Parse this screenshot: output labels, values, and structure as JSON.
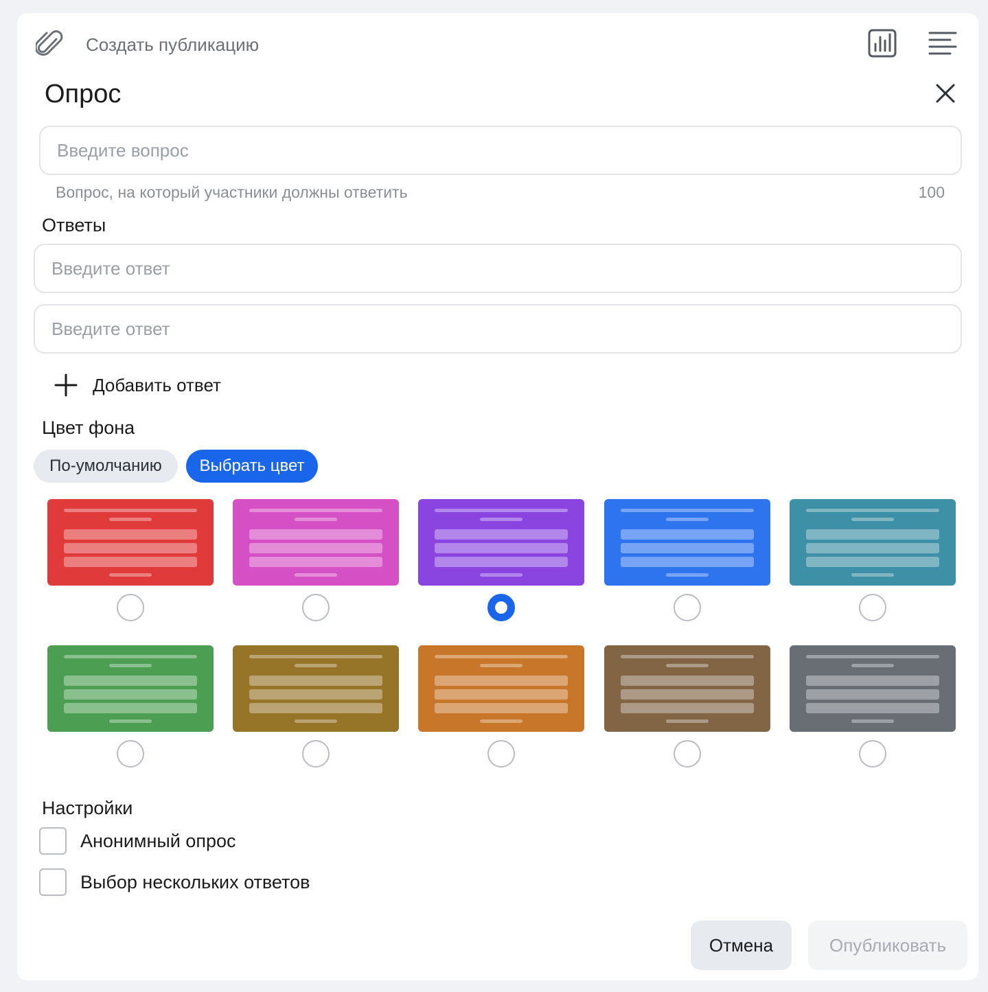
{
  "header": {
    "create_post": "Создать публикацию",
    "icons": [
      "paperclip-icon",
      "poll-chart-icon",
      "menu-lines-icon",
      "close-icon"
    ]
  },
  "poll": {
    "title": "Опрос",
    "question": {
      "placeholder": "Введите вопрос",
      "value": "",
      "hint": "Вопрос, на который участники должны ответить",
      "counter": "100"
    },
    "answers_label": "Ответы",
    "answers": [
      {
        "placeholder": "Введите ответ",
        "value": ""
      },
      {
        "placeholder": "Введите ответ",
        "value": ""
      }
    ],
    "add_answer": "Добавить ответ"
  },
  "background": {
    "label": "Цвет фона",
    "tabs": [
      {
        "label": "По-умолчанию",
        "active": false
      },
      {
        "label": "Выбрать цвет",
        "active": true
      }
    ],
    "accent": "#1a66ea",
    "selected_index": 2,
    "swatches": [
      {
        "name": "red",
        "color": "#e03a3a"
      },
      {
        "name": "pink",
        "color": "#d550c4"
      },
      {
        "name": "purple",
        "color": "#8a45e0"
      },
      {
        "name": "blue",
        "color": "#2f74ef"
      },
      {
        "name": "teal",
        "color": "#3d90a5"
      },
      {
        "name": "green",
        "color": "#4c9e52"
      },
      {
        "name": "olive",
        "color": "#967428"
      },
      {
        "name": "orange",
        "color": "#c8762a"
      },
      {
        "name": "brown",
        "color": "#826545"
      },
      {
        "name": "gray",
        "color": "#696d74"
      }
    ]
  },
  "settings": {
    "label": "Настройки",
    "options": [
      {
        "label": "Анонимный опрос",
        "checked": false
      },
      {
        "label": "Выбор нескольких ответов",
        "checked": false
      }
    ]
  },
  "footer": {
    "cancel": "Отмена",
    "publish": "Опубликовать",
    "publish_disabled": true
  }
}
